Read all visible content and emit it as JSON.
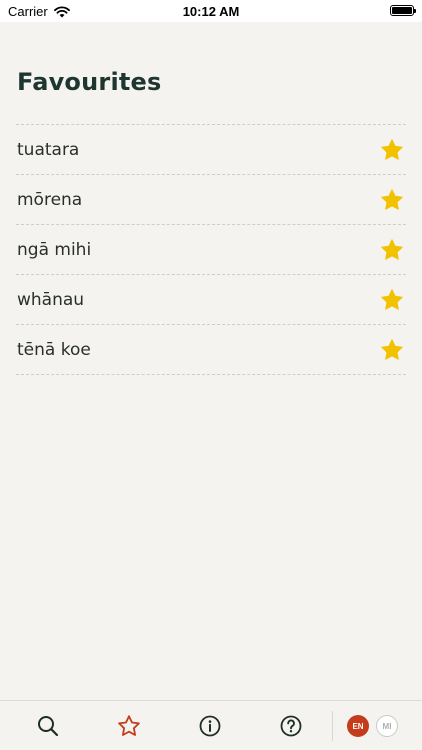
{
  "status_bar": {
    "carrier": "Carrier",
    "time": "10:12 AM",
    "battery_level": 1.0
  },
  "page": {
    "title": "Favourites"
  },
  "favourites": [
    {
      "word": "tuatara",
      "favourited": true
    },
    {
      "word": "mōrena",
      "favourited": true
    },
    {
      "word": "ngā mihi",
      "favourited": true
    },
    {
      "word": "whānau",
      "favourited": true
    },
    {
      "word": "tēnā koe",
      "favourited": true
    }
  ],
  "tab_bar": {
    "tabs": [
      {
        "name": "search",
        "icon": "search-icon",
        "active": false
      },
      {
        "name": "favourites",
        "icon": "star-icon",
        "active": true
      },
      {
        "name": "info",
        "icon": "info-icon",
        "active": false
      },
      {
        "name": "help",
        "icon": "help-icon",
        "active": false
      }
    ],
    "languages": [
      {
        "code": "EN",
        "selected": true
      },
      {
        "code": "MI",
        "selected": false
      }
    ]
  },
  "colors": {
    "background": "#f4f3f0",
    "title": "#1e3530",
    "star": "#f2c200",
    "accent": "#c43c1c",
    "icon": "#1e2d28"
  }
}
